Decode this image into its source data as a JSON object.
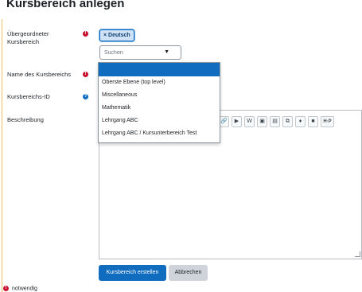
{
  "page": {
    "title": "Kursbereich anlegen"
  },
  "form": {
    "parent": {
      "label_line1": "Übergeordneter",
      "label_line2": "Kursbereich",
      "required_icon": "exclamation-icon",
      "selected_chip": "× Deutsch",
      "search_placeholder": "Suchen",
      "caret": "▼"
    },
    "name": {
      "label": "Name des Kursbereichs",
      "required_icon": "exclamation-icon"
    },
    "idnumber": {
      "label": "Kursbereichs-ID",
      "help_icon": "question-icon"
    },
    "description": {
      "label": "Beschreibung"
    }
  },
  "dropdown": {
    "items": [
      {
        "label": ""
      },
      {
        "label": "Oberste Ebene (top level)"
      },
      {
        "label": "Miscellaneous"
      },
      {
        "label": "Mathematik"
      },
      {
        "label": "Lehrgang ABC"
      },
      {
        "label": "Lehrgang ABC / Kursunterbereich Test"
      }
    ]
  },
  "toolbar": {
    "buttons": [
      {
        "icon": "link-icon",
        "glyph": "🔗"
      },
      {
        "icon": "video-icon",
        "glyph": "▶"
      },
      {
        "icon": "wiki-icon",
        "glyph": "W"
      },
      {
        "icon": "image-icon",
        "glyph": "▣"
      },
      {
        "icon": "file-icon",
        "glyph": "▤"
      },
      {
        "icon": "copy-icon",
        "glyph": "⧉"
      },
      {
        "icon": "microphone-icon",
        "glyph": "♦"
      },
      {
        "icon": "camera-icon",
        "glyph": "■"
      },
      {
        "icon": "h5p-icon",
        "glyph": "H·P"
      }
    ]
  },
  "actions": {
    "submit_label": "Kursbereich erstellen",
    "cancel_label": "Abbrechen"
  },
  "footer": {
    "note": "notwendig"
  },
  "colors": {
    "primary": "#0f6cbf",
    "required": "#c8102e",
    "secondary": "#ced4da"
  }
}
